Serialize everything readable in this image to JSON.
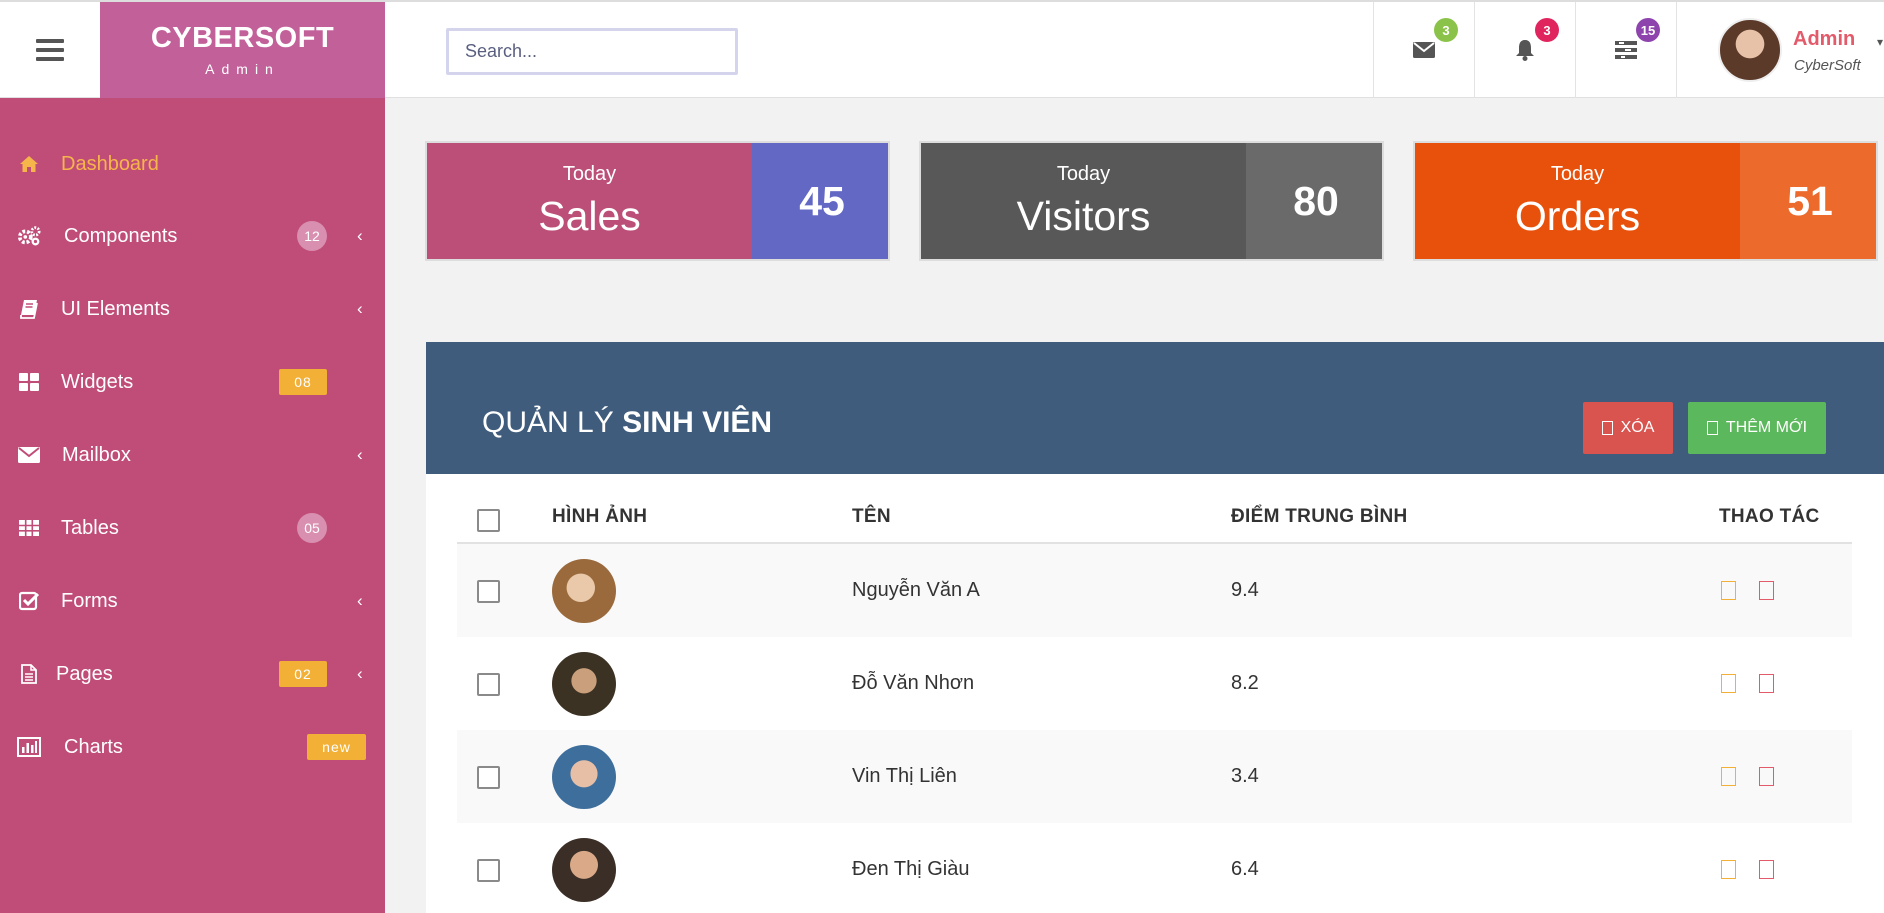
{
  "brand": {
    "name": "CYBERSOFT",
    "sub": "Admin"
  },
  "search": {
    "placeholder": "Search..."
  },
  "header_icons": [
    {
      "icon": "envelope-icon",
      "badge": "3",
      "badge_color": "#8bc34a"
    },
    {
      "icon": "bell-icon",
      "badge": "3",
      "badge_color": "#e0245e"
    },
    {
      "icon": "tasks-icon",
      "badge": "15",
      "badge_color": "#8e44ad"
    }
  ],
  "user": {
    "name": "Admin",
    "role": "CyberSoft"
  },
  "sidebar": {
    "items": [
      {
        "label": "Dashboard",
        "icon": "home-icon",
        "active": true
      },
      {
        "label": "Components",
        "icon": "gears-icon",
        "count": "12",
        "chevron": true
      },
      {
        "label": "UI Elements",
        "icon": "book-icon",
        "chevron": true
      },
      {
        "label": "Widgets",
        "icon": "th-large-icon",
        "count": "08"
      },
      {
        "label": "Mailbox",
        "icon": "envelope-icon",
        "chevron": true
      },
      {
        "label": "Tables",
        "icon": "table-icon",
        "count": "05"
      },
      {
        "label": "Forms",
        "icon": "check-square-icon",
        "chevron": true
      },
      {
        "label": "Pages",
        "icon": "file-icon",
        "count": "02",
        "chevron": true
      },
      {
        "label": "Charts",
        "icon": "bar-chart-icon",
        "count": "new"
      }
    ]
  },
  "stats": [
    {
      "top": "Today",
      "label": "Sales",
      "value": "45",
      "left_color": "#bc4f78",
      "right_color": "#6368c4"
    },
    {
      "top": "Today",
      "label": "Visitors",
      "value": "80",
      "left_color": "#585858",
      "right_color": "#6a6a6a"
    },
    {
      "top": "Today",
      "label": "Orders",
      "value": "51",
      "left_color": "#e8510b",
      "right_color": "#ec6a2c"
    }
  ],
  "panel": {
    "title_light": "QUẢN LÝ",
    "title_bold": "SINH VIÊN",
    "delete_label": "XÓA",
    "add_label": "THÊM MỚI"
  },
  "table": {
    "headers": {
      "image": "HÌNH ẢNH",
      "name": "TÊN",
      "score": "ĐIỂM TRUNG BÌNH",
      "actions": "THAO TÁC"
    },
    "rows": [
      {
        "name": "Nguyễn Văn A",
        "score": "9.4"
      },
      {
        "name": "Đỗ Văn Nhơn",
        "score": "8.2"
      },
      {
        "name": "Vin Thị Liên",
        "score": "3.4"
      },
      {
        "name": "Đen Thị Giàu",
        "score": "6.4"
      }
    ]
  },
  "colors": {
    "accent": "#c04d78",
    "panel_header": "#3f5c7c",
    "active_nav": "#f6b54a"
  }
}
